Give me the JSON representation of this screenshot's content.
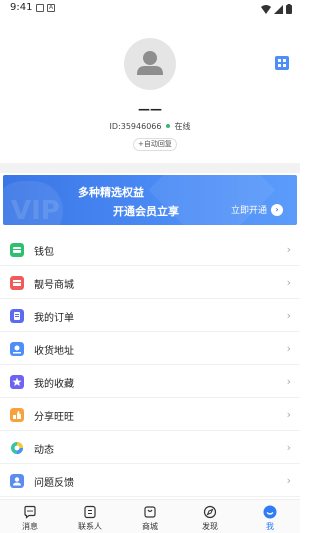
{
  "status_bar": {
    "time": "9:41"
  },
  "profile": {
    "nickname": "——",
    "id_text": "ID:35946066",
    "online_text": "在线",
    "auto_reply": "+自动回复"
  },
  "banner": {
    "title": "多种精选权益",
    "subtitle": "开通会员立享",
    "button": "立即开通",
    "watermark": "VIP"
  },
  "menu": [
    {
      "label": "钱包",
      "icon": "wallet-icon",
      "color": "#2fbf71"
    },
    {
      "label": "靓号商城",
      "icon": "shop-icon",
      "color": "#f05a5a"
    },
    {
      "label": "我的订单",
      "icon": "order-icon",
      "color": "#5b6cf0"
    },
    {
      "label": "收货地址",
      "icon": "address-icon",
      "color": "#4d8ef7"
    },
    {
      "label": "我的收藏",
      "icon": "star-icon",
      "color": "#6f63f2"
    },
    {
      "label": "分享旺旺",
      "icon": "share-icon",
      "color": "#f7a23b"
    },
    {
      "label": "动态",
      "icon": "moments-icon",
      "color": "#36c3a5"
    },
    {
      "label": "问题反馈",
      "icon": "feedback-icon",
      "color": "#5b8df0"
    }
  ],
  "tabs": [
    {
      "label": "消息",
      "icon": "message-icon"
    },
    {
      "label": "联系人",
      "icon": "contacts-icon"
    },
    {
      "label": "商城",
      "icon": "mall-icon"
    },
    {
      "label": "发现",
      "icon": "discover-icon"
    },
    {
      "label": "我",
      "icon": "me-icon"
    }
  ],
  "colors": {
    "accent": "#2e7cf6",
    "banner": "#4b8bf5"
  }
}
